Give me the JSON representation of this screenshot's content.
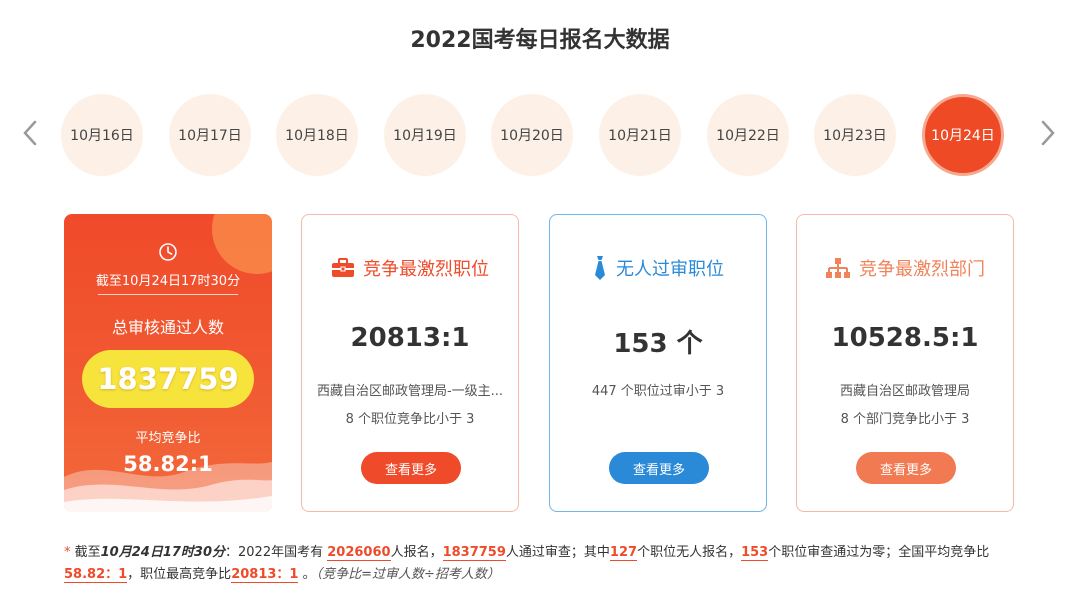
{
  "page": {
    "title": "2022国考每日报名大数据"
  },
  "dates": [
    {
      "label": "10月16日",
      "active": false
    },
    {
      "label": "10月17日",
      "active": false
    },
    {
      "label": "10月18日",
      "active": false
    },
    {
      "label": "10月19日",
      "active": false
    },
    {
      "label": "10月20日",
      "active": false
    },
    {
      "label": "10月21日",
      "active": false
    },
    {
      "label": "10月22日",
      "active": false
    },
    {
      "label": "10月23日",
      "active": false
    },
    {
      "label": "10月24日",
      "active": true
    }
  ],
  "summary": {
    "time": "截至10月24日17时30分",
    "label": "总审核通过人数",
    "total": "1837759",
    "avg_label": "平均竞争比",
    "avg": "58.82:1"
  },
  "cards": [
    {
      "title": "竞争最激烈职位",
      "value": "20813:1",
      "line1": "西藏自治区邮政管理局-一级主...",
      "line2": "8 个职位竞争比小于 3",
      "button": "查看更多",
      "icon": "briefcase-icon"
    },
    {
      "title": "无人过审职位",
      "value": "153 个",
      "line1": "447 个职位过审小于 3",
      "line2": "",
      "button": "查看更多",
      "icon": "tie-icon"
    },
    {
      "title": "竞争最激烈部门",
      "value": "10528.5:1",
      "line1": "西藏自治区邮政管理局",
      "line2": "8 个部门竞争比小于 3",
      "button": "查看更多",
      "icon": "org-chart-icon"
    }
  ],
  "footnote": {
    "star": "*",
    "t1": " 截至",
    "time": "10月24日17时30分",
    "t2": "：2022年国考有 ",
    "applicants": "2026060",
    "t3": "人报名，",
    "passed": "1837759",
    "t4": "人通过审查；其中",
    "no_apply": "127",
    "t5": "个职位无人报名，",
    "no_pass": "153",
    "t6": "个职位审查通过为零；全国平均竞争比",
    "avg": "58.82：1",
    "t7": "，职位最高竞争比",
    "max": "20813：1",
    "t8": " 。",
    "note": "（竞争比=过审人数÷招考人数）"
  },
  "colors": {
    "accent": "#ef4b2a",
    "blue": "#2b8ad8",
    "orange": "#f27a53",
    "pill": "#f6e43d"
  }
}
